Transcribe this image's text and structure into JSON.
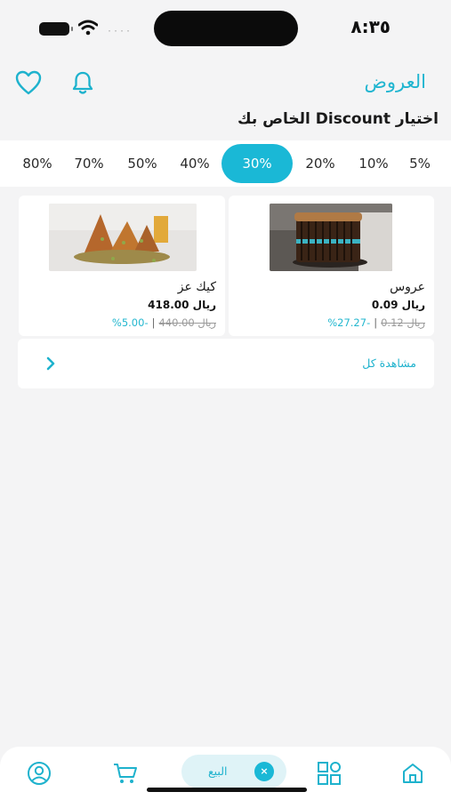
{
  "status_bar": {
    "time": "٨:٣٥",
    "signal": "····"
  },
  "header": {
    "title": "العروض"
  },
  "section": {
    "title": "اختيار Discount الخاص بك"
  },
  "discount_options": [
    {
      "label": "5%",
      "selected": false
    },
    {
      "label": "10%",
      "selected": false
    },
    {
      "label": "20%",
      "selected": false
    },
    {
      "label": "30%",
      "selected": true
    },
    {
      "label": "40%",
      "selected": false
    },
    {
      "label": "50%",
      "selected": false
    },
    {
      "label": "70%",
      "selected": false
    },
    {
      "label": "80%",
      "selected": false
    }
  ],
  "products": [
    {
      "name": "عروس",
      "price": "ريال 0.09",
      "old_price": "ريال 0.12",
      "separator": "|",
      "discount": "-27.27%"
    },
    {
      "name": "كيك عز",
      "price": "ريال 418.00",
      "old_price": "ريال 440.00",
      "separator": "|",
      "discount": "-5.00%"
    }
  ],
  "view_all": {
    "label": "مشاهدة كل"
  },
  "bottom_nav": {
    "sell_label": "البيع",
    "sell_badge": "×"
  },
  "colors": {
    "accent": "#1ab8d6",
    "background": "#f4f4f5"
  }
}
